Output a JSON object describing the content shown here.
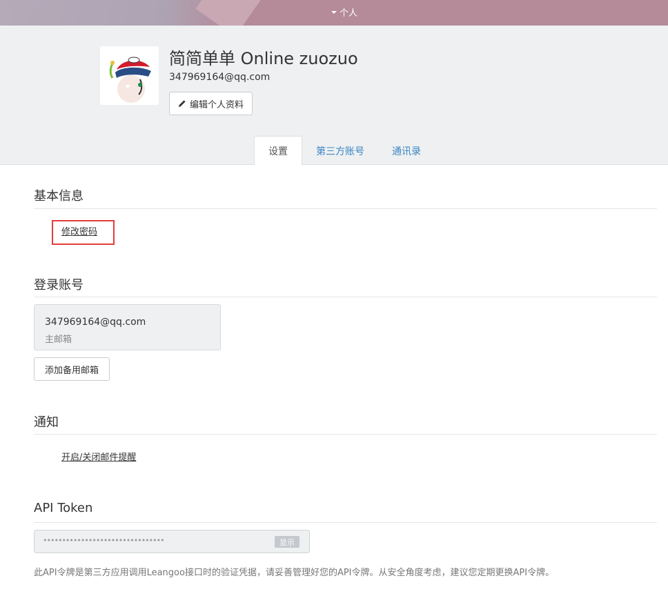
{
  "topbar": {
    "menu_label": "个人"
  },
  "profile": {
    "name": "简简单单 Online zuozuo",
    "email": "347969164@qq.com",
    "edit_button": "编辑个人资料"
  },
  "tabs": [
    {
      "label": "设置",
      "active": true
    },
    {
      "label": "第三方账号",
      "active": false
    },
    {
      "label": "通讯录",
      "active": false
    }
  ],
  "basic_info": {
    "title": "基本信息",
    "change_password": "修改密码"
  },
  "login_account": {
    "title": "登录账号",
    "email": "347969164@qq.com",
    "email_type": "主邮箱",
    "add_button": "添加备用邮箱"
  },
  "notification": {
    "title": "通知",
    "toggle_link": "开启/关闭邮件提醒"
  },
  "api_token": {
    "title": "API Token",
    "masked_value": "••••••••••••••••••••••••••••••••",
    "show_button": "显示",
    "help": "此API令牌是第三方应用调用Leangoo接口时的验证凭据，请妥善管理好您的API令牌。从安全角度考虑，建议您定期更换API令牌。"
  },
  "colors": {
    "link": "#3b86c4",
    "highlight": "#e33b3b",
    "topbar": "#b58a99"
  }
}
